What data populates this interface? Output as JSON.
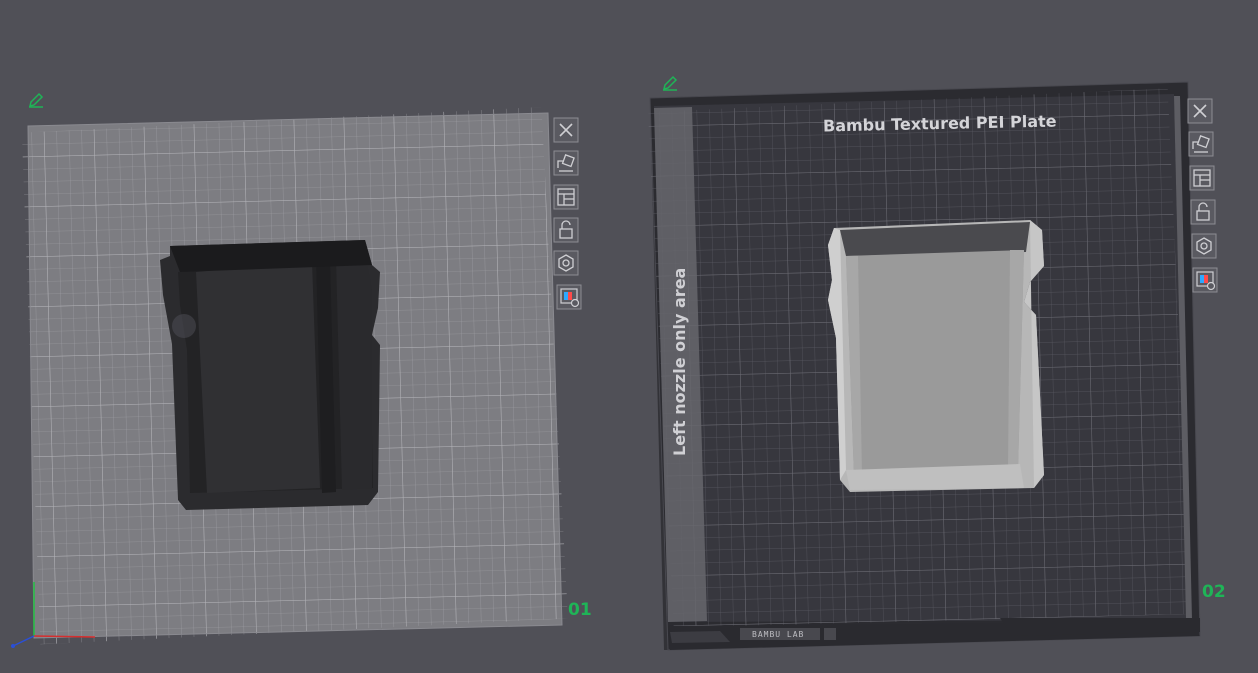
{
  "plates": [
    {
      "id": "plate-1",
      "number": "01",
      "tools": [
        "close-icon",
        "arrange-icon",
        "layout-icon",
        "lock-icon",
        "settings-icon",
        "filament-icon"
      ]
    },
    {
      "id": "plate-2",
      "number": "02",
      "title": "Bambu Textured PEI Plate",
      "nozzle_area": "Left nozzle only area",
      "brand_strip": "BAMBU LAB",
      "tools": [
        "close-icon",
        "arrange-icon",
        "layout-icon",
        "lock-icon",
        "settings-icon",
        "filament-icon"
      ]
    }
  ],
  "colors": {
    "background": "#505057",
    "plate1_surface": "#7d7d82",
    "plate2_surface": "#37373e",
    "plate_number": "#1fb457",
    "edit_icon": "#1fb457",
    "model_dark": "#2c2c2e",
    "model_light": "#b5b5b5"
  }
}
